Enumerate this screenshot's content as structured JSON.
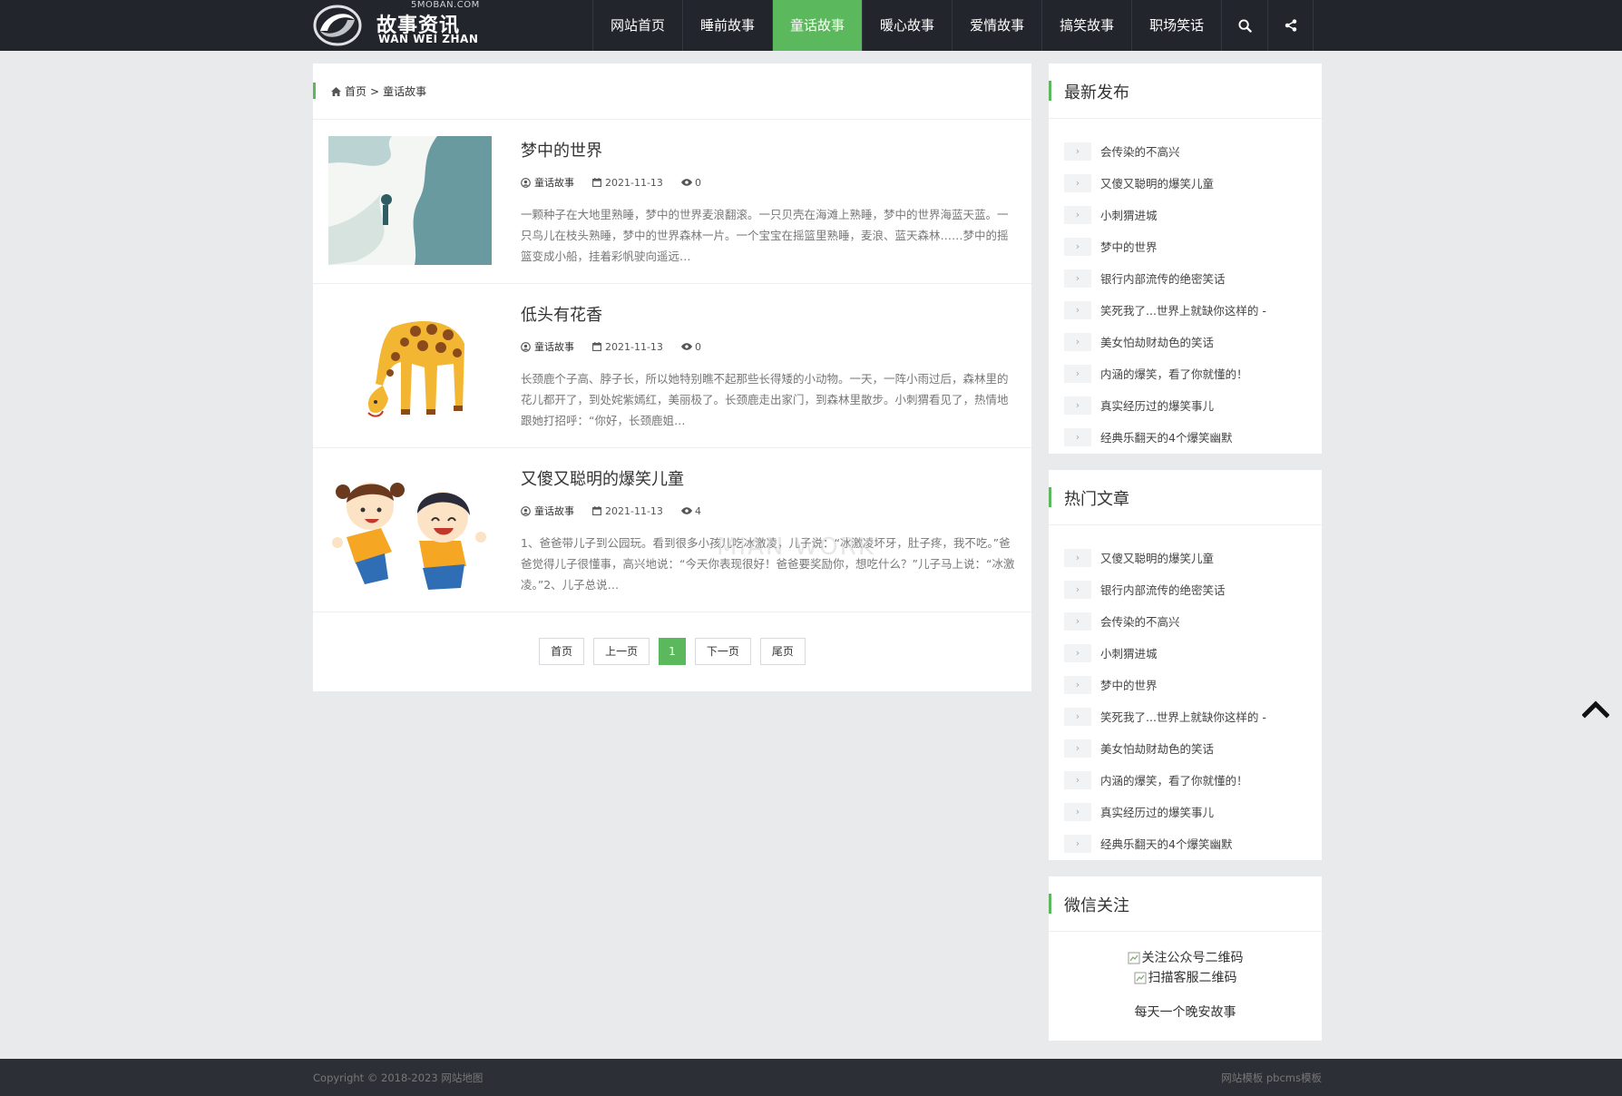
{
  "header": {
    "logo_domain": "5MOBAN.COM",
    "logo_cn": "故事资讯",
    "logo_en": "WAN WEI ZHAN",
    "nav": [
      {
        "label": "网站首页",
        "active": false
      },
      {
        "label": "睡前故事",
        "active": false
      },
      {
        "label": "童话故事",
        "active": true
      },
      {
        "label": "暖心故事",
        "active": false
      },
      {
        "label": "爱情故事",
        "active": false
      },
      {
        "label": "搞笑故事",
        "active": false
      },
      {
        "label": "职场笑话",
        "active": false
      }
    ],
    "icons": [
      "search-icon",
      "share-icon"
    ]
  },
  "breadcrumb": {
    "home": "首页",
    "separator": ">",
    "current": "童话故事"
  },
  "posts": [
    {
      "title": "梦中的世界",
      "category": "童话故事",
      "date": "2021-11-13",
      "views": "0",
      "excerpt": "一颗种子在大地里熟睡，梦中的世界麦浪翻滚。一只贝壳在海滩上熟睡，梦中的世界海蓝天蓝。一只鸟儿在枝头熟睡，梦中的世界森林一片。一个宝宝在摇篮里熟睡，麦浪、蓝天森林……梦中的摇篮变成小船，挂着彩帆驶向遥远…"
    },
    {
      "title": "低头有花香",
      "category": "童话故事",
      "date": "2021-11-13",
      "views": "0",
      "excerpt": "长颈鹿个子高、脖子长，所以她特别瞧不起那些长得矮的小动物。一天，一阵小雨过后，森林里的花儿都开了，到处姹紫嫣红，美丽极了。长颈鹿走出家门，到森林里散步。小刺猬看见了，热情地跟她打招呼：“你好，长颈鹿姐…"
    },
    {
      "title": "又傻又聪明的爆笑儿童",
      "category": "童话故事",
      "date": "2021-11-13",
      "views": "4",
      "excerpt": "1、爸爸带儿子到公园玩。看到很多小孩儿吃冰激凌，儿子说：“冰激凌坏牙，肚子疼，我不吃。”爸爸觉得儿子很懂事，高兴地说：“今天你表现很好！爸爸要奖励你，想吃什么？”儿子马上说：“冰激凌。”2、儿子总说…"
    }
  ],
  "pagination": {
    "first": "首页",
    "prev": "上一页",
    "current": "1",
    "next": "下一页",
    "last": "尾页"
  },
  "sidebar": {
    "latest": {
      "title": "最新发布",
      "items": [
        "会传染的不高兴",
        "又傻又聪明的爆笑儿童",
        "小刺猬进城",
        "梦中的世界",
        "银行内部流传的绝密笑话",
        "笑死我了...世界上就缺你这样的 -",
        "美女怕劫财劫色的笑话",
        "内涵的爆笑，看了你就懂的！",
        "真实经历过的爆笑事儿",
        "经典乐翻天的4个爆笑幽默"
      ]
    },
    "hot": {
      "title": "热门文章",
      "items": [
        "又傻又聪明的爆笑儿童",
        "银行内部流传的绝密笑话",
        "会传染的不高兴",
        "小刺猬进城",
        "梦中的世界",
        "笑死我了...世界上就缺你这样的 -",
        "美女怕劫财劫色的笑话",
        "内涵的爆笑，看了你就懂的！",
        "真实经历过的爆笑事儿",
        "经典乐翻天的4个爆笑幽默"
      ]
    },
    "wechat": {
      "title": "微信关注",
      "qr1_alt": "关注公众号二维码",
      "qr2_alt": "扫描客服二维码",
      "caption": "每天一个晚安故事"
    },
    "arrow": "›"
  },
  "watermark": "MIAN WORK",
  "footer": {
    "left": "Copyright © 2018-2023 网站地图",
    "right": "网站模板 pbcms模板"
  },
  "colors": {
    "accent": "#5cb85c",
    "topbar": "#22252c",
    "background": "#e9eaec",
    "footer": "#2c2f35"
  }
}
